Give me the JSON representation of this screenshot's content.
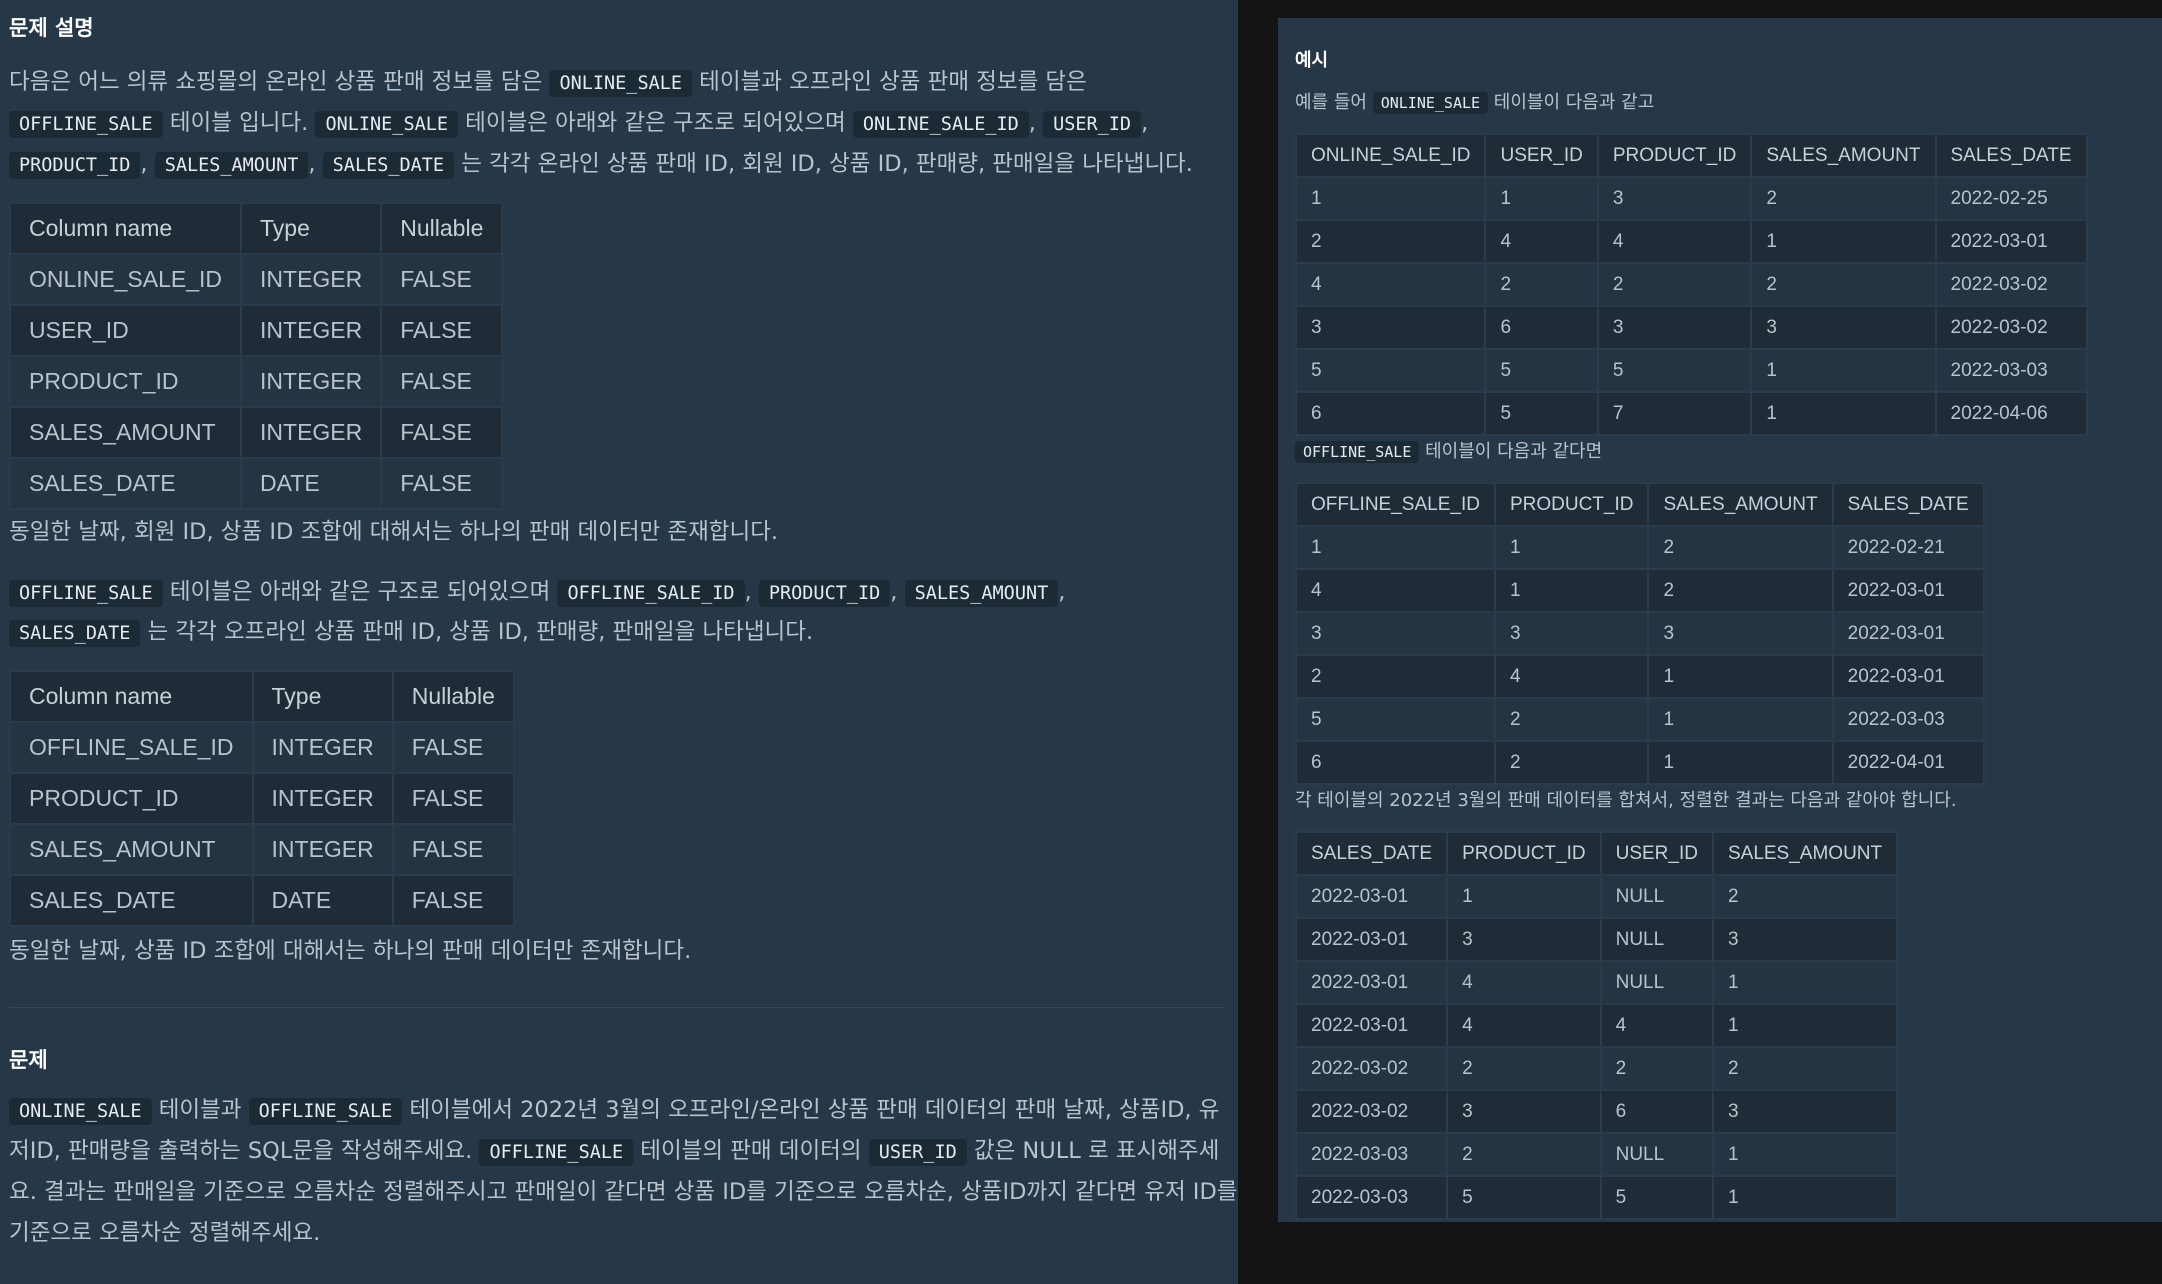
{
  "left": {
    "heading": "문제 설명",
    "intro": {
      "l1_a": "다음은 어느 의류 쇼핑몰의 온라인 상품 판매 정보를 담은",
      "l1_code": "ONLINE_SALE",
      "l1_b": "테이블과 오프라인 상품 판매 정보를 담은",
      "l2_code1": "OFFLINE_SALE",
      "l2_a": "테이블 입니다.",
      "l2_code2": "ONLINE_SALE",
      "l2_b": "테이블은 아래와 같은 구조로 되어있으며",
      "l2_code3": "ONLINE_SALE_ID",
      "l2_code4": "USER_ID",
      "comma": ",",
      "l3_code1": "PRODUCT_ID",
      "l3_code2": "SALES_AMOUNT",
      "l3_code3": "SALES_DATE",
      "l3_a": "는 각각 온라인 상품 판매 ID, 회원 ID, 상품 ID, 판매량, 판매일을 나타냅니다."
    },
    "online_schema": {
      "headers": [
        "Column name",
        "Type",
        "Nullable"
      ],
      "rows": [
        [
          "ONLINE_SALE_ID",
          "INTEGER",
          "FALSE"
        ],
        [
          "USER_ID",
          "INTEGER",
          "FALSE"
        ],
        [
          "PRODUCT_ID",
          "INTEGER",
          "FALSE"
        ],
        [
          "SALES_AMOUNT",
          "INTEGER",
          "FALSE"
        ],
        [
          "SALES_DATE",
          "DATE",
          "FALSE"
        ]
      ]
    },
    "note1": "동일한 날짜, 회원 ID, 상품 ID 조합에 대해서는 하나의 판매 데이터만 존재합니다.",
    "offline_intro": {
      "code1": "OFFLINE_SALE",
      "a": "테이블은 아래와 같은 구조로 되어있으며",
      "code2": "OFFLINE_SALE_ID",
      "code3": "PRODUCT_ID",
      "code4": "SALES_AMOUNT",
      "comma": ",",
      "code5": "SALES_DATE",
      "b": "는 각각 오프라인 상품 판매 ID, 상품 ID, 판매량, 판매일을 나타냅니다."
    },
    "offline_schema": {
      "headers": [
        "Column name",
        "Type",
        "Nullable"
      ],
      "rows": [
        [
          "OFFLINE_SALE_ID",
          "INTEGER",
          "FALSE"
        ],
        [
          "PRODUCT_ID",
          "INTEGER",
          "FALSE"
        ],
        [
          "SALES_AMOUNT",
          "INTEGER",
          "FALSE"
        ],
        [
          "SALES_DATE",
          "DATE",
          "FALSE"
        ]
      ]
    },
    "note2": "동일한 날짜, 상품 ID 조합에 대해서는 하나의 판매 데이터만 존재합니다.",
    "problem_heading": "문제",
    "problem": {
      "code1": "ONLINE_SALE",
      "a": "테이블과",
      "code2": "OFFLINE_SALE",
      "b": "테이블에서 2022년 3월의 오프라인/온라인 상품 판매 데이터의 판매 날짜, 상품ID, 유",
      "c": "저ID, 판매량을 출력하는 SQL문을 작성해주세요.",
      "code3": "OFFLINE_SALE",
      "d": "테이블의 판매 데이터의",
      "code4": "USER_ID",
      "e": "값은 NULL 로 표시해주세",
      "f": "요. 결과는 판매일을 기준으로 오름차순 정렬해주시고 판매일이 같다면 상품 ID를 기준으로 오름차순, 상품ID까지 같다면 유저 ID를",
      "g": "기준으로 오름차순 정렬해주세요."
    }
  },
  "right": {
    "heading": "예시",
    "ex1_a": "예를 들어",
    "ex1_code": "ONLINE_SALE",
    "ex1_b": "테이블이 다음과 같고",
    "online_table": {
      "headers": [
        "ONLINE_SALE_ID",
        "USER_ID",
        "PRODUCT_ID",
        "SALES_AMOUNT",
        "SALES_DATE"
      ],
      "rows": [
        [
          "1",
          "1",
          "3",
          "2",
          "2022-02-25"
        ],
        [
          "2",
          "4",
          "4",
          "1",
          "2022-03-01"
        ],
        [
          "4",
          "2",
          "2",
          "2",
          "2022-03-02"
        ],
        [
          "3",
          "6",
          "3",
          "3",
          "2022-03-02"
        ],
        [
          "5",
          "5",
          "5",
          "1",
          "2022-03-03"
        ],
        [
          "6",
          "5",
          "7",
          "1",
          "2022-04-06"
        ]
      ]
    },
    "ex2_code": "OFFLINE_SALE",
    "ex2_b": "테이블이 다음과 같다면",
    "offline_table": {
      "headers": [
        "OFFLINE_SALE_ID",
        "PRODUCT_ID",
        "SALES_AMOUNT",
        "SALES_DATE"
      ],
      "rows": [
        [
          "1",
          "1",
          "2",
          "2022-02-21"
        ],
        [
          "4",
          "1",
          "2",
          "2022-03-01"
        ],
        [
          "3",
          "3",
          "3",
          "2022-03-01"
        ],
        [
          "2",
          "4",
          "1",
          "2022-03-01"
        ],
        [
          "5",
          "2",
          "1",
          "2022-03-03"
        ],
        [
          "6",
          "2",
          "1",
          "2022-04-01"
        ]
      ]
    },
    "result_text": "각 테이블의 2022년 3월의 판매 데이터를 합쳐서, 정렬한 결과는 다음과 같아야 합니다.",
    "result_table": {
      "headers": [
        "SALES_DATE",
        "PRODUCT_ID",
        "USER_ID",
        "SALES_AMOUNT"
      ],
      "rows": [
        [
          "2022-03-01",
          "1",
          "NULL",
          "2"
        ],
        [
          "2022-03-01",
          "3",
          "NULL",
          "3"
        ],
        [
          "2022-03-01",
          "4",
          "NULL",
          "1"
        ],
        [
          "2022-03-01",
          "4",
          "4",
          "1"
        ],
        [
          "2022-03-02",
          "2",
          "2",
          "2"
        ],
        [
          "2022-03-02",
          "3",
          "6",
          "3"
        ],
        [
          "2022-03-03",
          "2",
          "NULL",
          "1"
        ],
        [
          "2022-03-03",
          "5",
          "5",
          "1"
        ]
      ]
    }
  }
}
